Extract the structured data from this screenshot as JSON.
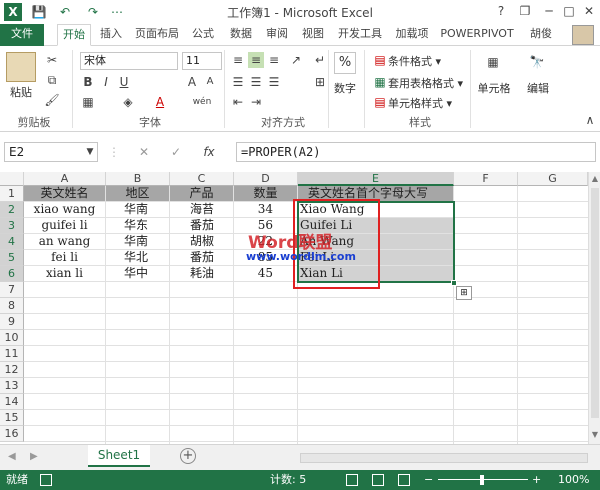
{
  "window": {
    "title": "工作簿1 - Microsoft Excel",
    "help": "?",
    "restore": "❐",
    "minimize": "─",
    "maximize": "□",
    "close": "✕"
  },
  "quick_access": {
    "app_icon": "X",
    "save": "💾",
    "undo": "↶",
    "redo": "↷",
    "customize": "⋯"
  },
  "tabs": [
    "文件",
    "开始",
    "插入",
    "页面布局",
    "公式",
    "数据",
    "审阅",
    "视图",
    "开发工具",
    "加载项",
    "POWERPIVOT"
  ],
  "user": "胡俊",
  "ribbon": {
    "clipboard": {
      "paste": "粘贴",
      "label": "剪贴板"
    },
    "font": {
      "name": "宋体",
      "size": "11",
      "bold": "B",
      "italic": "I",
      "underline": "U",
      "label": "字体",
      "grow": "A",
      "shrink": "A",
      "phonetic": "wén"
    },
    "alignment": {
      "label": "对齐方式"
    },
    "number": {
      "button": "数字",
      "icon": "%"
    },
    "styles": {
      "conditional": "条件格式 ▾",
      "table": "套用表格格式 ▾",
      "cell": "单元格样式 ▾",
      "label": "样式"
    },
    "cells": {
      "button": "单元格"
    },
    "editing": {
      "button": "编辑"
    }
  },
  "formula_bar": {
    "name_box": "E2",
    "cancel": "✕",
    "enter": "✓",
    "fx": "fx",
    "formula": "=PROPER(A2)"
  },
  "columns": [
    "A",
    "B",
    "C",
    "D",
    "E",
    "F",
    "G"
  ],
  "rows": [
    "1",
    "2",
    "3",
    "4",
    "5",
    "6",
    "7",
    "8",
    "9",
    "10",
    "11",
    "12",
    "13",
    "14",
    "15",
    "16"
  ],
  "table": {
    "headers": [
      "英文姓名",
      "地区",
      "产品",
      "数量",
      "英文姓名首个字母大写"
    ],
    "rows": [
      [
        "xiao wang",
        "华南",
        "海苔",
        "34",
        "Xiao Wang"
      ],
      [
        "guifei li",
        "华东",
        "番茄",
        "56",
        "Guifei Li"
      ],
      [
        "an wang",
        "华南",
        "胡椒",
        "22",
        "An Wang"
      ],
      [
        "fei li",
        "华北",
        "番茄",
        "85",
        "Fei Li"
      ],
      [
        "xian li",
        "华中",
        "耗油",
        "45",
        "Xian Li"
      ]
    ]
  },
  "watermark": {
    "line1": "Word联盟",
    "line2": "www.wordlm.com"
  },
  "sheets": [
    "Sheet1"
  ],
  "add_sheet": "+",
  "status": {
    "ready": "就绪",
    "count": "计数: 5",
    "zoom": "100%",
    "zoom_minus": "−",
    "zoom_plus": "+"
  },
  "accent": "#217346"
}
